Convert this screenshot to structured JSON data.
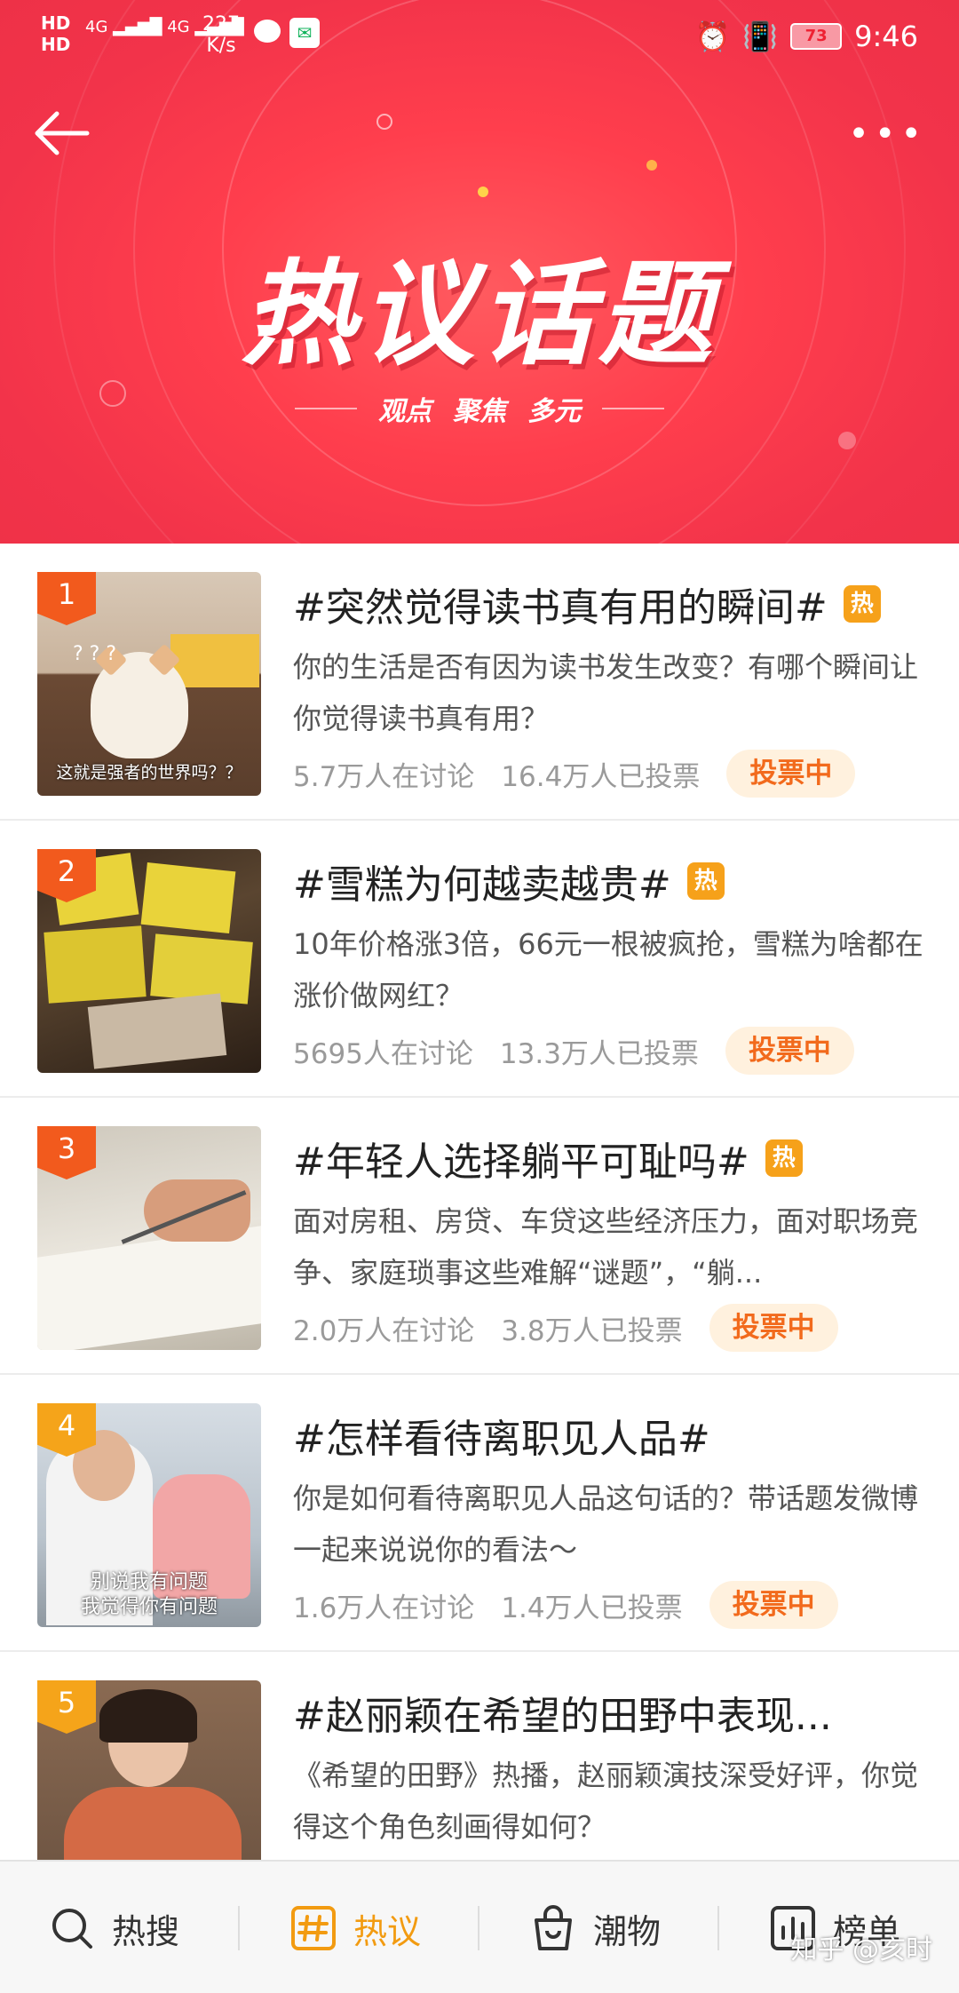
{
  "status_bar": {
    "hd1": "HD",
    "hd2": "HD",
    "net1": "4G",
    "net2": "4G",
    "speed_value": "227",
    "speed_unit": "K/s",
    "battery": "73",
    "time": "9:46"
  },
  "header": {
    "title": "热议话题",
    "slogan": [
      "观点",
      "聚焦",
      "多元"
    ]
  },
  "topics": [
    {
      "rank": "1",
      "title": "#突然觉得读书真有用的瞬间#",
      "hot_badge": "热",
      "desc": "你的生活是否有因为读书发生改变？有哪个瞬间让你觉得读书真有用？",
      "discussing": "5.7万人在讨论",
      "voted": "16.4万人已投票",
      "vote_label": "投票中",
      "thumb_caption": "这就是强者的世界吗？？",
      "rank_color": "#f25a1d"
    },
    {
      "rank": "2",
      "title": "#雪糕为何越卖越贵#",
      "hot_badge": "热",
      "desc": "10年价格涨3倍，66元一根被疯抢，雪糕为啥都在涨价做网红？",
      "discussing": "5695人在讨论",
      "voted": "13.3万人已投票",
      "vote_label": "投票中",
      "thumb_caption": "",
      "rank_color": "#f25a1d"
    },
    {
      "rank": "3",
      "title": "#年轻人选择躺平可耻吗#",
      "hot_badge": "热",
      "desc": "面对房租、房贷、车贷这些经济压力，面对职场竞争、家庭琐事这些难解“谜题”，“躺...",
      "discussing": "2.0万人在讨论",
      "voted": "3.8万人已投票",
      "vote_label": "投票中",
      "thumb_caption": "",
      "rank_color": "#f25a1d"
    },
    {
      "rank": "4",
      "title": "#怎样看待离职见人品#",
      "hot_badge": "",
      "desc": "你是如何看待离职见人品这句话的？带话题发微博一起来说说你的看法～",
      "discussing": "1.6万人在讨论",
      "voted": "1.4万人已投票",
      "vote_label": "投票中",
      "thumb_caption": "别说我有问题\n我觉得你有问题",
      "rank_color": "#f5a41a"
    },
    {
      "rank": "5",
      "title": "#赵丽颖在希望的田野中表现...",
      "hot_badge": "",
      "desc": "《希望的田野》热播，赵丽颖演技深受好评，你觉得这个角色刻画得如何？",
      "discussing": "",
      "voted": "",
      "vote_label": "",
      "thumb_caption": "",
      "rank_color": "#f5a41a"
    }
  ],
  "tabbar": {
    "tabs": [
      {
        "label": "热搜",
        "icon": "search-icon"
      },
      {
        "label": "热议",
        "icon": "hashtag-icon"
      },
      {
        "label": "潮物",
        "icon": "shopping-bag-icon"
      },
      {
        "label": "榜单",
        "icon": "chart-icon"
      }
    ],
    "active": "热议"
  },
  "watermark": "知乎 @亥时"
}
